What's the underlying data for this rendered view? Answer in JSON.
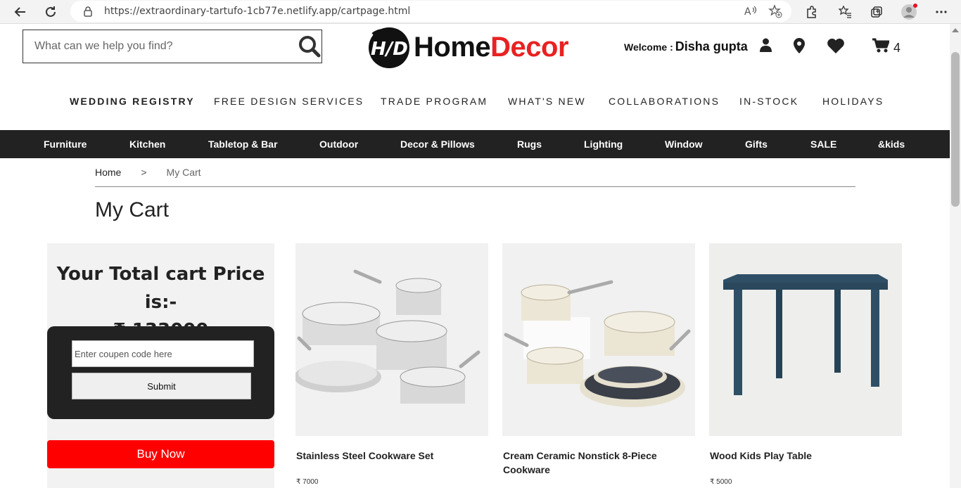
{
  "browser": {
    "url": "https://extraordinary-tartufo-1cb77e.netlify.app/cartpage.html",
    "icons": [
      "back-arrow-icon",
      "refresh-icon",
      "lock-icon",
      "read-aloud-icon",
      "add-favorite-icon",
      "extensions-icon",
      "favorites-icon",
      "collections-icon",
      "profile-icon",
      "more-icon"
    ]
  },
  "header": {
    "search_placeholder": "What can we help you find?",
    "logo_badge": "H/D",
    "logo_word_1": "Home",
    "logo_word_2": "Decor",
    "welcome_label": "Welcome :",
    "user_name": "Disha gupta",
    "cart_count": "4"
  },
  "top_nav": [
    "WEDDING REGISTRY",
    "FREE DESIGN SERVICES",
    "TRADE PROGRAM",
    "WHAT'S NEW",
    "COLLABORATIONS",
    "IN-STOCK",
    "HOLIDAYS"
  ],
  "categories": [
    "Furniture",
    "Kitchen",
    "Tabletop & Bar",
    "Outdoor",
    "Decor & Pillows",
    "Rugs",
    "Lighting",
    "Window",
    "Gifts",
    "SALE",
    "&kids"
  ],
  "breadcrumb": {
    "home": "Home",
    "sep": ">",
    "current": "My Cart"
  },
  "page_title": "My Cart",
  "summary": {
    "total_label": "Your Total cart Price is:-",
    "total_value": "₹ 133000",
    "coupon_placeholder": "Enter coupen code here",
    "submit_label": "Submit",
    "buy_label": "Buy Now"
  },
  "products": [
    {
      "name": "Stainless Steel Cookware Set",
      "price": "₹ 7000"
    },
    {
      "name": "Cream Ceramic Nonstick 8-Piece Cookware",
      "price": ""
    },
    {
      "name": "Wood Kids Play Table",
      "price": "₹ 5000"
    }
  ],
  "colors": {
    "accent_red": "#e82222",
    "buy_button": "#ff0000",
    "category_bar": "#222222",
    "table_blue": "#2f4f66"
  }
}
